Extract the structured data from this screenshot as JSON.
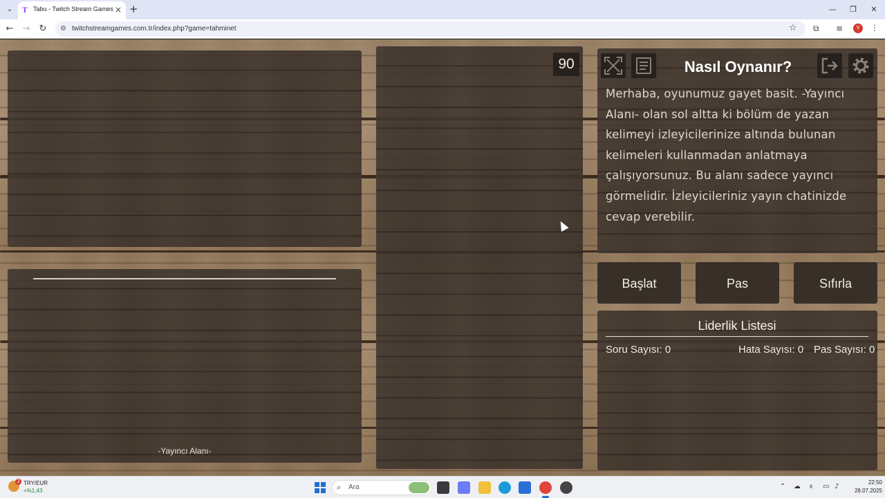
{
  "browser": {
    "tab_title": "Tabu - Twitch Stream Games",
    "tab_favicon": "T",
    "url": "twitchstreamgames.com.tr/index.php?game=tahminet",
    "profile_initial": "Y"
  },
  "game": {
    "timer": "90",
    "streamer_area_label": "-Yayıncı Alanı-",
    "info": {
      "title": "Nasıl Oynanır?",
      "text": "Merhaba, oyunumuz gayet basit. -Yayıncı Alanı- olan sol altta ki bölüm de yazan kelimeyi izleyicilerinize altında bulunan kelimeleri kullanmadan anlatmaya çalışıyorsunuz. Bu alanı sadece yayıncı görmelidir. İzleyicileriniz yayın chatinizde cevap verebilir."
    },
    "buttons": {
      "start": "Başlat",
      "pass": "Pas",
      "reset": "Sıfırla"
    },
    "leaderboard": {
      "title": "Liderlik Listesi",
      "question_count": "Soru Sayısı: 0",
      "error_count": "Hata Sayısı: 0",
      "pass_count": "Pas Sayısı: 0"
    },
    "icons": [
      "fullscreen-icon",
      "notes-icon",
      "exit-icon",
      "settings-icon"
    ]
  },
  "taskbar": {
    "ticker_name": "TRY/EUR",
    "ticker_change": "+%1,43",
    "weather_badge": "2",
    "search_placeholder": "Ara",
    "time": "22:50",
    "date": "28.07.2025"
  },
  "colors": {
    "panel": "#3e342c",
    "wood": "#9b8266",
    "accent_twitch": "#9146ff"
  }
}
